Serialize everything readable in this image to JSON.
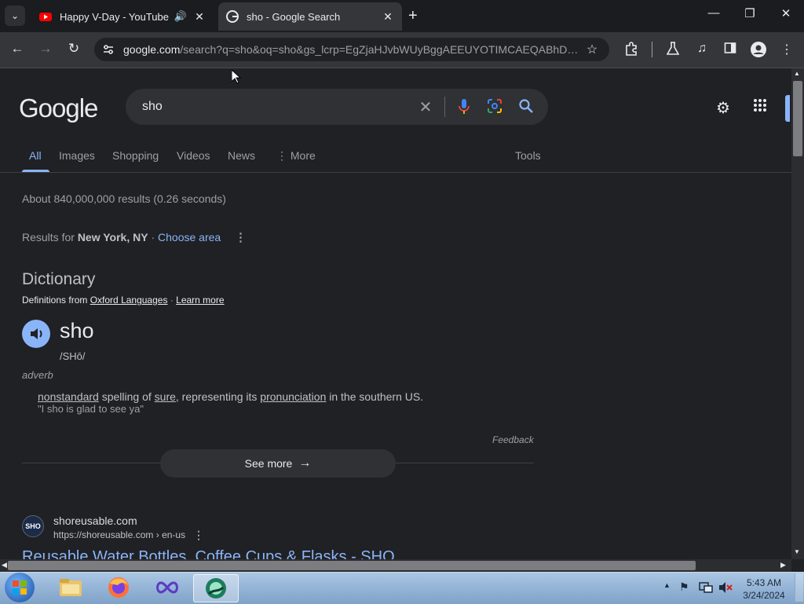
{
  "browser": {
    "tabs": [
      {
        "title": "Happy V-Day - YouTube",
        "active": false,
        "audio": true
      },
      {
        "title": "sho - Google Search",
        "active": true,
        "audio": false
      }
    ],
    "url_host": "google.com",
    "url_rest": "/search?q=sho&oq=sho&gs_lcrp=EgZjaHJvbWUyBggAEEUYOTIMCAEQABhDGIA..."
  },
  "google": {
    "logo": "Google",
    "query": "sho",
    "nav_tabs": [
      "All",
      "Images",
      "Shopping",
      "Videos",
      "News",
      "More"
    ],
    "more_prefix": "⋮",
    "tools": "Tools",
    "results_stats": "About 840,000,000 results (0.26 seconds)",
    "location_prefix": "Results for",
    "location": "New York, NY",
    "location_sep": "·",
    "choose_area": "Choose area"
  },
  "dictionary": {
    "heading": "Dictionary",
    "definitions_from": "Definitions from",
    "source": "Oxford Languages",
    "sep": "·",
    "learn_more": "Learn more",
    "word": "sho",
    "phonetic": "/SHō/",
    "pos": "adverb",
    "def_w1": "nonstandard",
    "def_t1": " spelling of ",
    "def_w2": "sure",
    "def_t2": ", representing its ",
    "def_w3": "pronunciation",
    "def_t3": " in the southern US.",
    "example": "\"I sho is glad to see ya\"",
    "feedback": "Feedback",
    "see_more": "See more"
  },
  "result": {
    "site_name": "shoreusable.com",
    "breadcrumb": "https://shoreusable.com › en-us",
    "favicon_text": "SHO",
    "title": "Reusable Water Bottles, Coffee Cups & Flasks - SHO"
  },
  "taskbar": {
    "time": "5:43 AM",
    "date": "3/24/2024"
  },
  "colors": {
    "background": "#202124",
    "link": "#8ab4f8",
    "accent_mic_blue": "#4285f4",
    "tab_active": "#35363a"
  }
}
